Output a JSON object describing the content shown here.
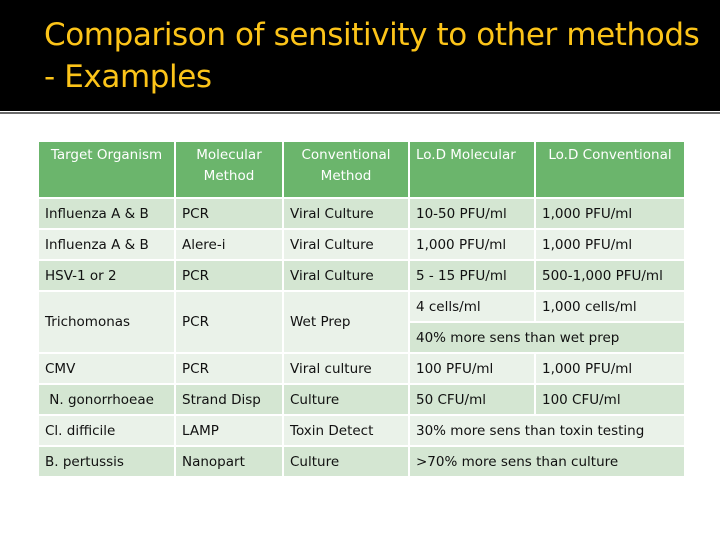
{
  "slide": {
    "title": "Comparison of sensitivity to other methods - Examples"
  },
  "table": {
    "headers": [
      "Target Organism",
      "Molecular Method",
      "Conventional Method",
      "Lo.D Molecular",
      "Lo.D Conventional"
    ],
    "rows": [
      {
        "organism": "Influenza A & B",
        "molecular": "PCR",
        "conventional": "Viral Culture",
        "lod_molecular": "10-50 PFU/ml",
        "lod_conventional": "1,000 PFU/ml"
      },
      {
        "organism": "Influenza A & B",
        "molecular": "Alere-i",
        "conventional": "Viral Culture",
        "lod_molecular": "1,000 PFU/ml",
        "lod_conventional": "1,000 PFU/ml"
      },
      {
        "organism": "HSV-1 or 2",
        "molecular": "PCR",
        "conventional": "Viral Culture",
        "lod_molecular": "5 - 15 PFU/ml",
        "lod_conventional": "500-1,000 PFU/ml"
      },
      {
        "organism": "Trichomonas",
        "molecular": "PCR",
        "conventional": "Wet Prep",
        "lod_molecular": "4 cells/ml",
        "lod_conventional": "1,000 cells/ml",
        "note": "40% more sens than wet prep"
      },
      {
        "organism": "CMV",
        "molecular": "PCR",
        "conventional": "Viral culture",
        "lod_molecular": "100 PFU/ml",
        "lod_conventional": "1,000 PFU/ml"
      },
      {
        "organism": " N. gonorrhoeae",
        "molecular": "Strand Disp",
        "conventional": "Culture",
        "lod_molecular": "50 CFU/ml",
        "lod_conventional": "100 CFU/ml"
      },
      {
        "organism": "Cl. difficile",
        "molecular": "LAMP",
        "conventional": "Toxin Detect",
        "lod_combined": "30% more sens than toxin testing"
      },
      {
        "organism": "B. pertussis",
        "molecular": "Nanopart",
        "conventional": "Culture",
        "lod_combined": ">70% more sens than culture"
      }
    ]
  },
  "colors": {
    "title_band": "#000000",
    "title_text": "#fcc419",
    "header_bg": "#6bb56c",
    "row_dark": "#d4e6d2",
    "row_light": "#eaf2e9"
  }
}
